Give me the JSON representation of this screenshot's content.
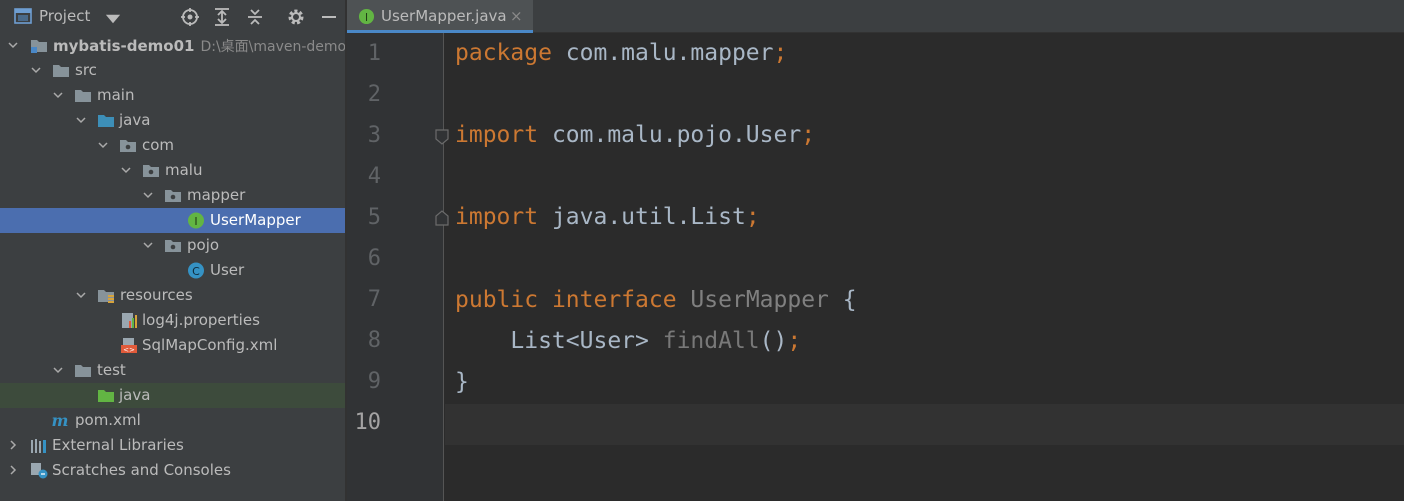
{
  "project_panel": {
    "title": "Project",
    "toolbar_icons": [
      "locate-icon",
      "expand-all-icon",
      "collapse-all-icon",
      "settings-icon",
      "hide-icon"
    ]
  },
  "tree": {
    "root_label": "mybatis-demo01",
    "root_path": "D:\\桌面\\maven-demo\\",
    "src": "src",
    "main": "main",
    "java": "java",
    "com": "com",
    "malu": "malu",
    "mapper": "mapper",
    "usermapper": "UserMapper",
    "pojo": "pojo",
    "user": "User",
    "resources": "resources",
    "log4j": "log4j.properties",
    "sqlmap": "SqlMapConfig.xml",
    "test": "test",
    "test_java": "java",
    "pom": "pom.xml",
    "external_libraries": "External Libraries",
    "scratches": "Scratches and Consoles"
  },
  "editor": {
    "tab_label": "UserMapper.java",
    "tab_close": "×",
    "line_numbers": [
      "1",
      "2",
      "3",
      "4",
      "5",
      "6",
      "7",
      "8",
      "9",
      "10"
    ],
    "code": {
      "l1_kw": "package",
      "l1_rest": " com.malu.mapper",
      "l3_kw": "import",
      "l3_rest": " com.malu.pojo.User",
      "l5_kw": "import",
      "l5_rest": " java.util.List",
      "l7_kw1": "public",
      "l7_kw2": " interface",
      "l7_name": " UserMapper",
      "l7_brace": " {",
      "l8_indent": "    ",
      "l8_type": "List<User>",
      "l8_method": " findAll",
      "l8_parens": "()",
      "l9_brace": "}",
      "semicolon": ";"
    }
  },
  "colors": {
    "keyword": "#cc7832",
    "text": "#a9b7c6",
    "selection": "#4b6eaf",
    "interface_name": "#808080"
  }
}
